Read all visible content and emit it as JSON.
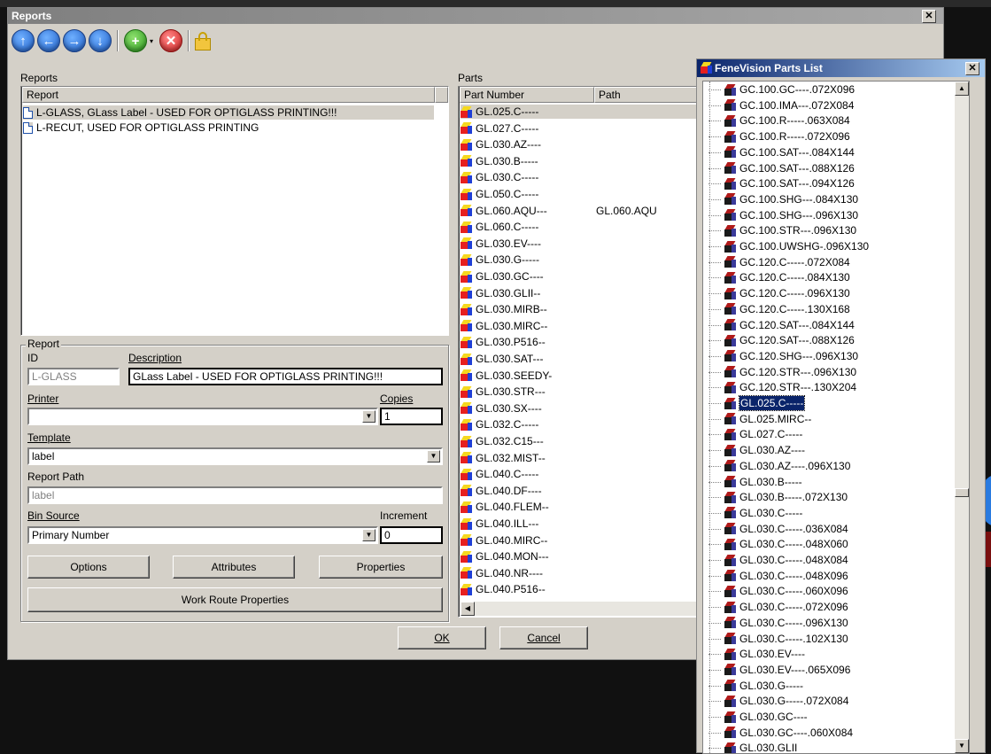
{
  "window": {
    "title": "Reports",
    "close_glyph": "✕"
  },
  "toolbar": {
    "buttons": [
      {
        "name": "up-arrow-icon",
        "glyph": "↑"
      },
      {
        "name": "left-arrow-icon",
        "glyph": "←"
      },
      {
        "name": "right-arrow-icon",
        "glyph": "→"
      },
      {
        "name": "down-arrow-icon",
        "glyph": "↓"
      }
    ],
    "add_glyph": "+",
    "drop_glyph": "▾",
    "delete_glyph": "✕"
  },
  "reports": {
    "label": "Reports",
    "column": "Report",
    "items": [
      {
        "text": "L-GLASS, GLass Label - USED FOR OPTIGLASS PRINTING!!!",
        "selected": true
      },
      {
        "text": "L-RECUT, USED FOR OPTIGLASS PRINTING",
        "selected": false
      }
    ]
  },
  "report_group": {
    "label": "Report",
    "id_label": "ID",
    "id_value": "L-GLASS",
    "description_label": "Description",
    "description_value": "GLass Label - USED FOR OPTIGLASS PRINTING!!!",
    "printer_label": "Printer",
    "printer_value": "",
    "copies_label": "Copies",
    "copies_value": "1",
    "template_label": "Template",
    "template_value": "label",
    "report_path_label": "Report Path",
    "report_path_value": "label",
    "bin_source_label": "Bin Source",
    "bin_source_value": "Primary Number",
    "increment_label": "Increment",
    "increment_value": "0"
  },
  "buttons": {
    "options": "Options",
    "attributes": "Attributes",
    "properties": "Properties",
    "work_route": "Work Route Properties",
    "ok": "OK",
    "cancel": "Cancel"
  },
  "parts": {
    "label": "Parts",
    "columns": [
      "Part Number",
      "Path"
    ],
    "rows": [
      {
        "part": "GL.025.C-----",
        "path": ""
      },
      {
        "part": "GL.027.C-----",
        "path": ""
      },
      {
        "part": "GL.030.AZ----",
        "path": ""
      },
      {
        "part": "GL.030.B-----",
        "path": ""
      },
      {
        "part": "GL.030.C-----",
        "path": ""
      },
      {
        "part": "GL.050.C-----",
        "path": ""
      },
      {
        "part": "GL.060.AQU---",
        "path": "GL.060.AQU"
      },
      {
        "part": "GL.060.C-----",
        "path": ""
      },
      {
        "part": "GL.030.EV----",
        "path": ""
      },
      {
        "part": "GL.030.G-----",
        "path": ""
      },
      {
        "part": "GL.030.GC----",
        "path": ""
      },
      {
        "part": "GL.030.GLII--",
        "path": ""
      },
      {
        "part": "GL.030.MIRB--",
        "path": ""
      },
      {
        "part": "GL.030.MIRC--",
        "path": ""
      },
      {
        "part": "GL.030.P516--",
        "path": ""
      },
      {
        "part": "GL.030.SAT---",
        "path": ""
      },
      {
        "part": "GL.030.SEEDY-",
        "path": ""
      },
      {
        "part": "GL.030.STR---",
        "path": ""
      },
      {
        "part": "GL.030.SX----",
        "path": ""
      },
      {
        "part": "GL.032.C-----",
        "path": ""
      },
      {
        "part": "GL.032.C15---",
        "path": ""
      },
      {
        "part": "GL.032.MIST--",
        "path": ""
      },
      {
        "part": "GL.040.C-----",
        "path": ""
      },
      {
        "part": "GL.040.DF----",
        "path": ""
      },
      {
        "part": "GL.040.FLEM--",
        "path": ""
      },
      {
        "part": "GL.040.ILL---",
        "path": ""
      },
      {
        "part": "GL.040.MIRC--",
        "path": ""
      },
      {
        "part": "GL.040.MON---",
        "path": ""
      },
      {
        "part": "GL.040.NR----",
        "path": ""
      },
      {
        "part": "GL.040.P516--",
        "path": ""
      }
    ]
  },
  "fenevision": {
    "title": "FeneVision Parts List",
    "close_glyph": "✕",
    "selected_index": 22,
    "items": [
      "GC.100.GC----.072X096",
      "GC.100.IMA---.072X084",
      "GC.100.R-----.063X084",
      "GC.100.R-----.072X096",
      "GC.100.SAT---.084X144",
      "GC.100.SAT---.088X126",
      "GC.100.SAT---.094X126",
      "GC.100.SHG---.084X130",
      "GC.100.SHG---.096X130",
      "GC.100.STR---.096X130",
      "GC.100.UWSHG-.096X130",
      "GC.120.C-----.072X084",
      "GC.120.C-----.084X130",
      "GC.120.C-----.096X130",
      "GC.120.C-----.130X168",
      "GC.120.SAT---.084X144",
      "GC.120.SAT---.088X126",
      "GC.120.SHG---.096X130",
      "GC.120.STR---.096X130",
      "GC.120.STR---.130X204",
      "GL.025.C-----",
      "GL.025.MIRC--",
      "GL.027.C-----",
      "GL.030.AZ----",
      "GL.030.AZ----.096X130",
      "GL.030.B-----",
      "GL.030.B-----.072X130",
      "GL.030.C-----",
      "GL.030.C-----.036X084",
      "GL.030.C-----.048X060",
      "GL.030.C-----.048X084",
      "GL.030.C-----.048X096",
      "GL.030.C-----.060X096",
      "GL.030.C-----.072X096",
      "GL.030.C-----.096X130",
      "GL.030.C-----.102X130",
      "GL.030.EV----",
      "GL.030.EV----.065X096",
      "GL.030.G-----",
      "GL.030.G-----.072X084",
      "GL.030.GC----",
      "GL.030.GC----.060X084",
      "GL.030.GLII"
    ]
  },
  "scroll_glyphs": {
    "up": "▲",
    "down": "▼",
    "left": "◀",
    "dropdown": "▼"
  },
  "colors": {
    "selection": "#0a246a",
    "window_face": "#d4d0c8"
  }
}
